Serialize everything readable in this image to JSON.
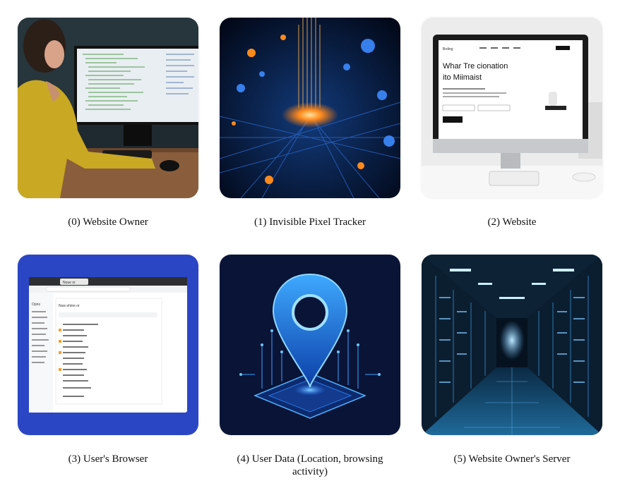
{
  "panels": [
    {
      "index": 0,
      "caption": "(0) Website Owner",
      "icon": "person-at-computer"
    },
    {
      "index": 1,
      "caption": "(1) Invisible Pixel Tracker",
      "icon": "glowing-pixel-circuit"
    },
    {
      "index": 2,
      "caption": "(2) Website",
      "icon": "desktop-website"
    },
    {
      "index": 3,
      "caption": "(3) User's Browser",
      "icon": "browser-window"
    },
    {
      "index": 4,
      "caption": "(4) User Data (Location, browsing activity)",
      "icon": "location-pin-chip"
    },
    {
      "index": 5,
      "caption": "(5) Website Owner's Server",
      "icon": "server-room"
    }
  ],
  "website_mockup": {
    "brand": "Brding",
    "heading_line1": "Whar Tre cionation",
    "heading_line2": "ito Miimaist"
  },
  "browser_mockup": {
    "tab_label": "Noue or",
    "sidebar_title": "Opns",
    "panel_title": "Nuw ehtne or"
  }
}
